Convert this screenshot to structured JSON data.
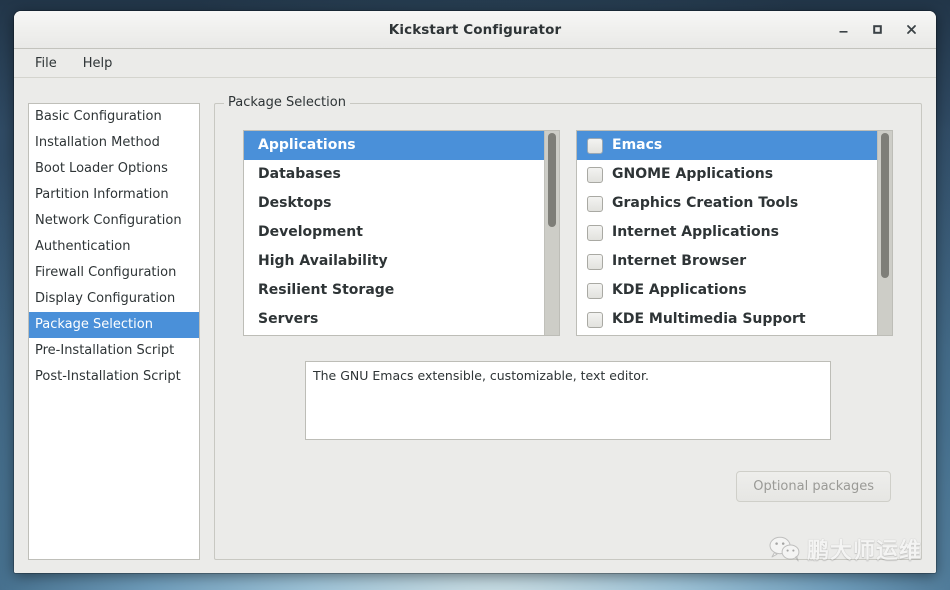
{
  "window": {
    "title": "Kickstart Configurator",
    "controls": [
      {
        "name": "minimize",
        "icon": "minimize-icon"
      },
      {
        "name": "maximize",
        "icon": "maximize-icon"
      },
      {
        "name": "close",
        "icon": "close-icon"
      }
    ]
  },
  "menubar": {
    "items": [
      {
        "label": "File"
      },
      {
        "label": "Help"
      }
    ]
  },
  "sidebar": {
    "items": [
      {
        "label": "Basic Configuration",
        "selected": false
      },
      {
        "label": "Installation Method",
        "selected": false
      },
      {
        "label": "Boot Loader Options",
        "selected": false
      },
      {
        "label": "Partition Information",
        "selected": false
      },
      {
        "label": "Network Configuration",
        "selected": false
      },
      {
        "label": "Authentication",
        "selected": false
      },
      {
        "label": "Firewall Configuration",
        "selected": false
      },
      {
        "label": "Display Configuration",
        "selected": false
      },
      {
        "label": "Package Selection",
        "selected": true
      },
      {
        "label": "Pre-Installation Script",
        "selected": false
      },
      {
        "label": "Post-Installation Script",
        "selected": false
      }
    ]
  },
  "group": {
    "label": "Package Selection"
  },
  "category_list": {
    "items": [
      {
        "label": "Applications",
        "selected": true
      },
      {
        "label": "Databases",
        "selected": false
      },
      {
        "label": "Desktops",
        "selected": false
      },
      {
        "label": "Development",
        "selected": false
      },
      {
        "label": "High Availability",
        "selected": false
      },
      {
        "label": "Resilient Storage",
        "selected": false
      },
      {
        "label": "Servers",
        "selected": false
      }
    ],
    "scrollbar": {
      "thumb_top_pct": 1,
      "thumb_height_pct": 46
    }
  },
  "package_list": {
    "items": [
      {
        "label": "Emacs",
        "checked": false,
        "selected": true
      },
      {
        "label": "GNOME Applications",
        "checked": false,
        "selected": false
      },
      {
        "label": "Graphics Creation Tools",
        "checked": false,
        "selected": false
      },
      {
        "label": "Internet Applications",
        "checked": false,
        "selected": false
      },
      {
        "label": "Internet Browser",
        "checked": false,
        "selected": false
      },
      {
        "label": "KDE Applications",
        "checked": false,
        "selected": false
      },
      {
        "label": "KDE Multimedia Support",
        "checked": false,
        "selected": false
      }
    ],
    "scrollbar": {
      "thumb_top_pct": 1,
      "thumb_height_pct": 71
    }
  },
  "description": {
    "text": "The GNU Emacs extensible, customizable, text editor."
  },
  "optional_packages_button": {
    "label": "Optional packages",
    "disabled": true
  },
  "watermark": {
    "text": "鹏大师运维",
    "icon": "wechat-icon"
  },
  "colors": {
    "selection_blue": "#4a90d9",
    "window_bg": "#ebebe9",
    "list_bg": "#ffffff",
    "text": "#2e3436",
    "disabled_text": "#9a9a96"
  }
}
